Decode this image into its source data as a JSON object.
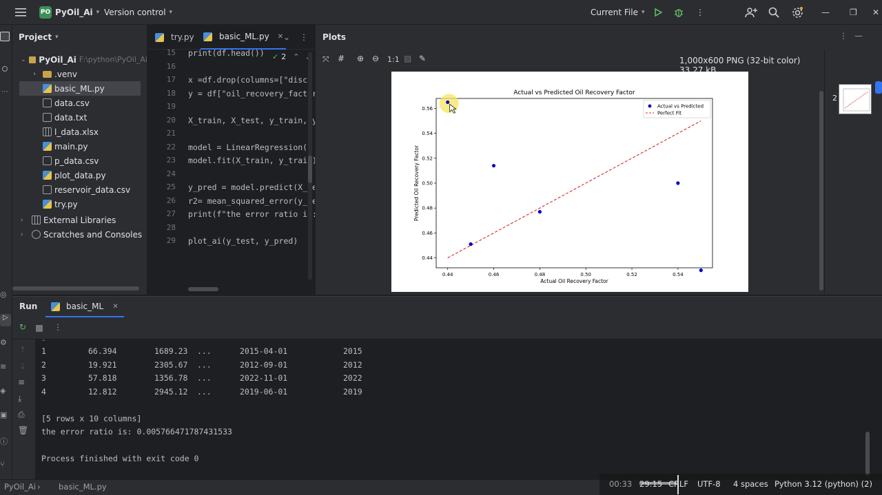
{
  "titlebar": {
    "project_badge": "PO",
    "project_name": "PyOil_Ai",
    "vcs": "Version control",
    "run_config": "Current File"
  },
  "project_panel": {
    "title": "Project",
    "root_name": "PyOil_Ai",
    "root_path": "F:\\python\\PyOil_Ai",
    "items": [
      {
        "label": ".venv",
        "type": "folder"
      },
      {
        "label": "basic_ML.py",
        "type": "py"
      },
      {
        "label": "data.csv",
        "type": "txt"
      },
      {
        "label": "data.txt",
        "type": "txt"
      },
      {
        "label": "l_data.xlsx",
        "type": "xls"
      },
      {
        "label": "main.py",
        "type": "py"
      },
      {
        "label": "p_data.csv",
        "type": "txt"
      },
      {
        "label": "plot_data.py",
        "type": "py"
      },
      {
        "label": "reservoir_data.csv",
        "type": "txt"
      },
      {
        "label": "try.py",
        "type": "py"
      }
    ],
    "external_libraries": "External Libraries",
    "scratches": "Scratches and Consoles"
  },
  "editor": {
    "tabs": [
      {
        "label": "try.py"
      },
      {
        "label": "basic_ML.py"
      }
    ],
    "inspection_count": "2",
    "lines": [
      {
        "num": "15",
        "text": "print(df.head())"
      },
      {
        "num": "16",
        "text": ""
      },
      {
        "num": "17",
        "text": "x =df.drop(columns=[\"disco"
      },
      {
        "num": "18",
        "text": "y = df[\"oil_recovery_factor"
      },
      {
        "num": "19",
        "text": ""
      },
      {
        "num": "20",
        "text": "X_train, X_test, y_train, y"
      },
      {
        "num": "21",
        "text": ""
      },
      {
        "num": "22",
        "text": "model = LinearRegression()"
      },
      {
        "num": "23",
        "text": "model.fit(X_train, y_train)"
      },
      {
        "num": "24",
        "text": ""
      },
      {
        "num": "25",
        "text": "y_pred = model.predict(X_te"
      },
      {
        "num": "26",
        "text": "r2= mean_squared_error(y_te"
      },
      {
        "num": "27",
        "text": "print(f\"the error ratio is:"
      },
      {
        "num": "28",
        "text": ""
      },
      {
        "num": "29",
        "text": "plot_ai(y_test, y_pred)"
      }
    ]
  },
  "plots": {
    "title": "Plots",
    "zoom_label": "1:1",
    "image_info": "1,000x600 PNG (32-bit color) 33.27 kB",
    "thumb_index": "2"
  },
  "chart_data": {
    "type": "scatter",
    "title": "Actual vs Predicted Oil Recovery Factor",
    "xlabel": "Actual Oil Recovery Factor",
    "ylabel": "Predicted Oil Recovery Factor",
    "xlim": [
      0.435,
      0.555
    ],
    "ylim": [
      0.432,
      0.568
    ],
    "xticks": [
      "0.44",
      "0.46",
      "0.48",
      "0.50",
      "0.52",
      "0.54"
    ],
    "yticks": [
      "0.44",
      "0.46",
      "0.48",
      "0.50",
      "0.52",
      "0.54",
      "0.56"
    ],
    "legend_position": "upper right",
    "series": [
      {
        "name": "Actual vs Predicted",
        "color": "#0000cc",
        "x": [
          0.44,
          0.45,
          0.46,
          0.48,
          0.54,
          0.55
        ],
        "y": [
          0.565,
          0.451,
          0.514,
          0.477,
          0.5,
          0.43
        ]
      },
      {
        "name": "Perfect Fit",
        "color": "#d62728",
        "x": [
          0.44,
          0.55
        ],
        "y": [
          0.44,
          0.55
        ]
      }
    ]
  },
  "run_panel": {
    "tab_run": "Run",
    "tab_file": "basic_ML",
    "rows": [
      {
        "idx": "1",
        "a": "66.394",
        "b": "1689.23",
        "dots": "...",
        "date": "2015-04-01",
        "year": "2015"
      },
      {
        "idx": "2",
        "a": "19.921",
        "b": "2305.67",
        "dots": "...",
        "date": "2012-09-01",
        "year": "2012"
      },
      {
        "idx": "3",
        "a": "57.818",
        "b": "1356.78",
        "dots": "...",
        "date": "2022-11-01",
        "year": "2022"
      },
      {
        "idx": "4",
        "a": "12.812",
        "b": "2945.12",
        "dots": "...",
        "date": "2019-06-01",
        "year": "2019"
      }
    ],
    "summary": "[5 rows x 10 columns]",
    "error_line": "the error ratio is: 0.005766471787431533",
    "exit_line": "Process finished with exit code 0"
  },
  "statusbar": {
    "project": "PyOil_Ai",
    "file": "basic_ML.py",
    "position": "29:15",
    "line_sep": "CRLF",
    "encoding": "UTF-8",
    "indent": "4 spaces",
    "interpreter": "Python 3.12 (python) (2)",
    "video_time": "00:33"
  },
  "colors": {
    "accent": "#3574f0",
    "green_run": "#5fb865",
    "debug": "#5fb865"
  }
}
